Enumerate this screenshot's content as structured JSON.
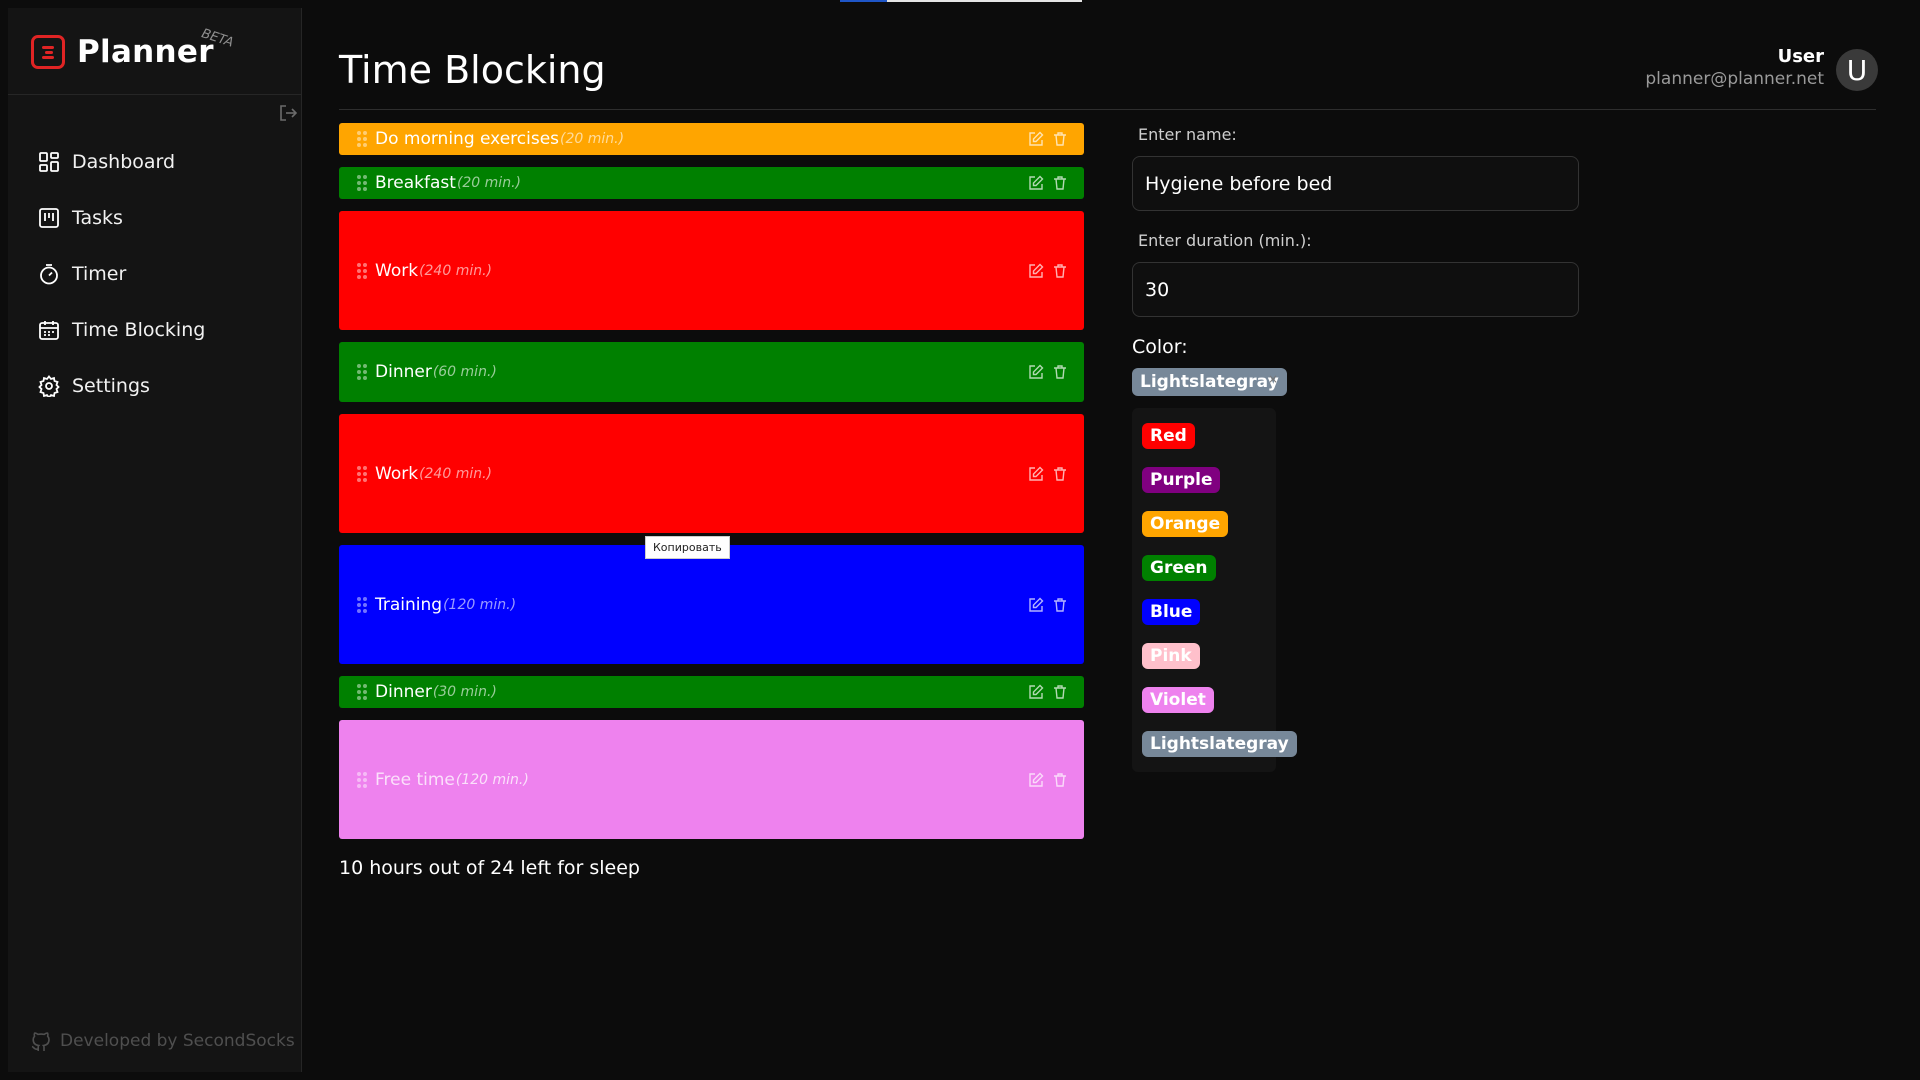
{
  "app": {
    "name": "Planner",
    "badge": "BETA",
    "footer": "Developed by SecondSocks"
  },
  "nav": [
    {
      "label": "Dashboard",
      "icon": "dashboard-icon"
    },
    {
      "label": "Tasks",
      "icon": "kanban-icon"
    },
    {
      "label": "Timer",
      "icon": "stopwatch-icon"
    },
    {
      "label": "Time Blocking",
      "icon": "calendar-icon"
    },
    {
      "label": "Settings",
      "icon": "gear-icon"
    }
  ],
  "header": {
    "title": "Time Blocking",
    "user_name": "User",
    "user_email": "planner@planner.net",
    "avatar_letter": "U"
  },
  "blocks": [
    {
      "name": "Do morning exercises",
      "duration": "(20 min.)",
      "color": "#ffa500"
    },
    {
      "name": "Breakfast",
      "duration": "(20 min.)",
      "color": "#008000"
    },
    {
      "name": "Work",
      "duration": "(240 min.)",
      "color": "#ff0000"
    },
    {
      "name": "Dinner",
      "duration": "(60 min.)",
      "color": "#008000"
    },
    {
      "name": "Work",
      "duration": "(240 min.)",
      "color": "#ff0000"
    },
    {
      "name": "Training",
      "duration": "(120 min.)",
      "color": "#0000ff"
    },
    {
      "name": "Dinner",
      "duration": "(30 min.)",
      "color": "#008000"
    },
    {
      "name": "Free time",
      "duration": "(120 min.)",
      "color": "#ee82ee"
    }
  ],
  "tooltip": "Копировать",
  "sleep_text": "10 hours out of 24 left for sleep",
  "form": {
    "name_label": "Enter name:",
    "name_value": "Hygiene before bed",
    "duration_label": "Enter duration (min.):",
    "duration_value": "30",
    "color_label": "Color:",
    "selected_color": "Lightslategray",
    "clear_symbol": "×",
    "colors": [
      {
        "label": "Red",
        "hex": "#ff0000",
        "text": "#ffffff"
      },
      {
        "label": "Purple",
        "hex": "#800080",
        "text": "#ffffff"
      },
      {
        "label": "Orange",
        "hex": "#ffa500",
        "text": "#ffffff"
      },
      {
        "label": "Green",
        "hex": "#008000",
        "text": "#ffffff"
      },
      {
        "label": "Blue",
        "hex": "#0000ff",
        "text": "#ffffff"
      },
      {
        "label": "Pink",
        "hex": "#ffc0cb",
        "text": "#ffffff"
      },
      {
        "label": "Violet",
        "hex": "#ee82ee",
        "text": "#ffffff"
      },
      {
        "label": "Lightslategray",
        "hex": "#778899",
        "text": "#ffffff"
      }
    ]
  }
}
